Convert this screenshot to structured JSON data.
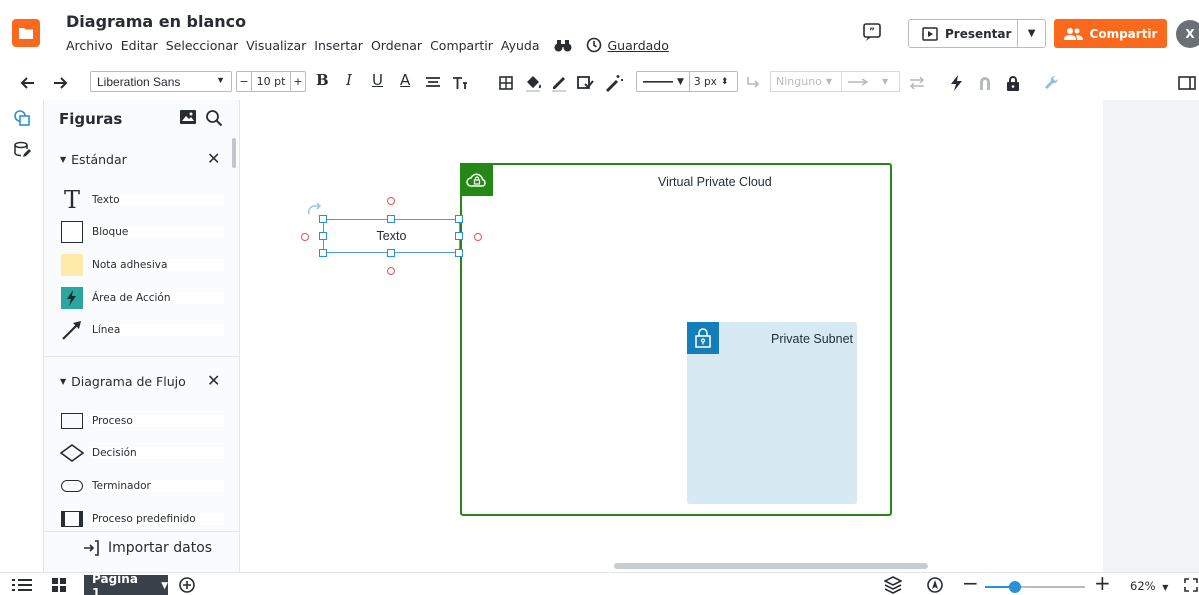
{
  "header": {
    "title": "Diagrama en blanco",
    "menu": [
      "Archivo",
      "Editar",
      "Seleccionar",
      "Visualizar",
      "Insertar",
      "Ordenar",
      "Compartir",
      "Ayuda"
    ],
    "saved_label": "Guardado",
    "present_label": "Presentar",
    "share_label": "Compartir",
    "avatar_initial": "X"
  },
  "toolbar": {
    "font_family": "Liberation Sans",
    "font_size": "10 pt",
    "size_minus": "−",
    "size_plus": "+",
    "bold": "B",
    "italic": "I",
    "underline": "U",
    "font_color": "A",
    "line_width": "3 px",
    "line_start": "Ninguno"
  },
  "panel": {
    "title": "Figuras",
    "sections": [
      {
        "name": "Estándar",
        "items": [
          "Texto",
          "Bloque",
          "Nota adhesiva",
          "Área de Acción",
          "Línea"
        ]
      },
      {
        "name": "Diagrama de Flujo",
        "items": [
          "Proceso",
          "Decisión",
          "Terminador",
          "Proceso predefinido"
        ]
      }
    ],
    "import_label": "Importar datos"
  },
  "canvas": {
    "vpc_label": "Virtual Private Cloud",
    "subnet_label": "Private Subnet",
    "text_shape": "Texto"
  },
  "bottombar": {
    "page_label": "Página 1",
    "zoom": "62%",
    "zoom_fraction": 0.3
  },
  "colors": {
    "brand": "#fb6a1c",
    "vpc_green": "#248814",
    "subnet_blue": "#147eba",
    "subnet_fill": "#d7e9f3",
    "selection": "#2b8fd6"
  }
}
